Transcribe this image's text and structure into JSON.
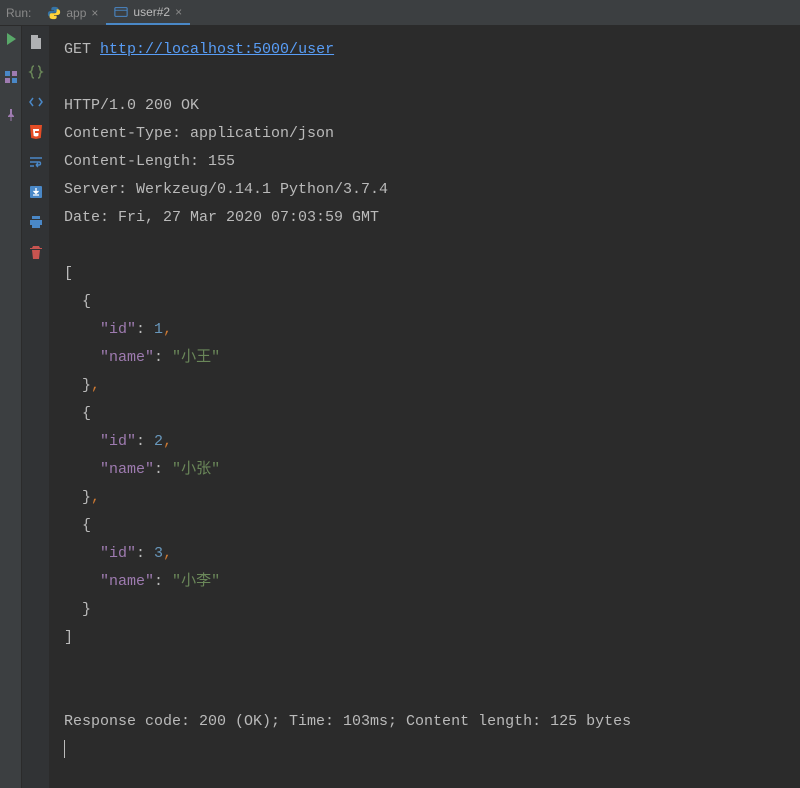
{
  "tabbar": {
    "run_label": "Run:",
    "tabs": [
      {
        "label": "app",
        "icon": "python-icon",
        "active": false
      },
      {
        "label": "user#2",
        "icon": "http-icon",
        "active": true
      }
    ]
  },
  "gutter_icons": [
    "play-icon",
    "struct-icon",
    "pin-icon"
  ],
  "tool_icons": [
    "file-icon",
    "braces-icon",
    "code-icon",
    "html5-icon",
    "wrap-icon",
    "download-icon",
    "print-icon",
    "trash-icon"
  ],
  "request": {
    "method": "GET",
    "url": "http://localhost:5000/user"
  },
  "response_headers": [
    "HTTP/1.0 200 OK",
    "Content-Type: application/json",
    "Content-Length: 155",
    "Server: Werkzeug/0.14.1 Python/3.7.4",
    "Date: Fri, 27 Mar 2020 07:03:59 GMT"
  ],
  "response_body": [
    {
      "id": 1,
      "name": "小王"
    },
    {
      "id": 2,
      "name": "小张"
    },
    {
      "id": 3,
      "name": "小李"
    }
  ],
  "json_labels": {
    "id": "\"id\"",
    "name": "\"name\""
  },
  "footer": "Response code: 200 (OK); Time: 103ms; Content length: 125 bytes"
}
